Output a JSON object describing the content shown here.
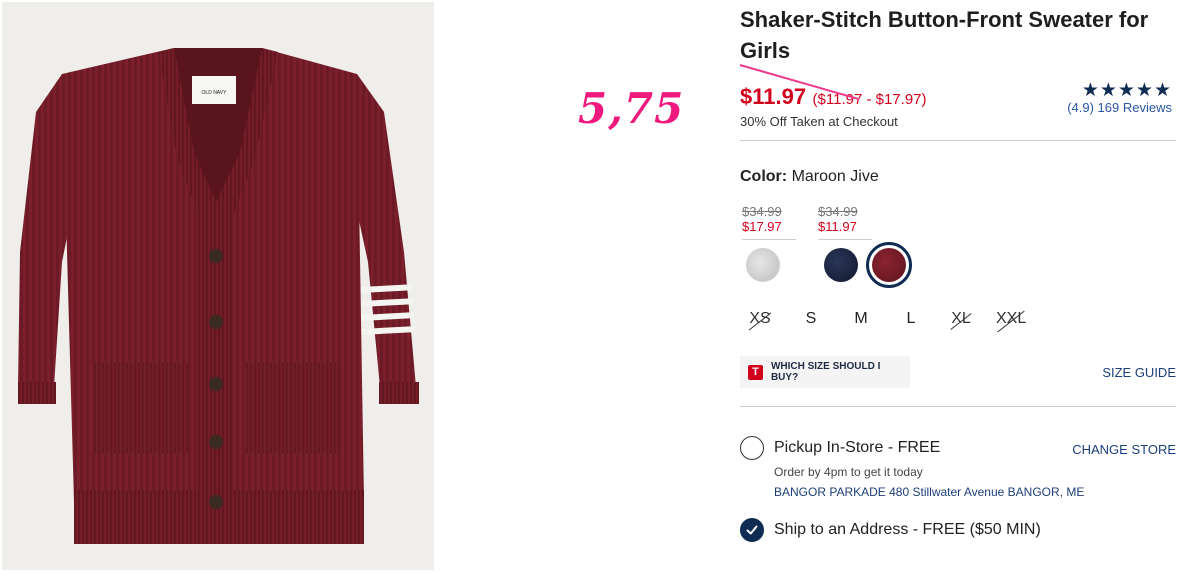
{
  "product": {
    "image_alt": "Maroon shaker-stitch cardigan sweater with white stripes on the sleeve",
    "brand_tag": "OLD NAVY",
    "title": "Shaker-Stitch Button-Front Sweater for Girls",
    "price_current": "$11.97",
    "price_range": "($11.97 - $17.97)",
    "discount_note": "30% Off Taken at Checkout",
    "handwritten_price": "5,75"
  },
  "rating": {
    "stars": "★★★★★",
    "reviews": "(4.9) 169 Reviews",
    "value": 4.9
  },
  "color": {
    "label": "Color:",
    "selected": "Maroon Jive",
    "price_groups": [
      {
        "old": "$34.99",
        "new": "$17.97"
      },
      {
        "old": "$34.99",
        "new": "$11.97"
      }
    ],
    "swatches": [
      {
        "name": "gray",
        "hex": "#c9c9c9"
      },
      {
        "name": "navy",
        "hex": "#1a2240"
      },
      {
        "name": "maroon",
        "hex": "#6e1a24"
      }
    ]
  },
  "sizes": [
    {
      "label": "XS",
      "available": false
    },
    {
      "label": "S",
      "available": true
    },
    {
      "label": "M",
      "available": true
    },
    {
      "label": "L",
      "available": true
    },
    {
      "label": "XL",
      "available": false
    },
    {
      "label": "XXL",
      "available": false
    }
  ],
  "size_help": {
    "icon_letter": "T",
    "label": "WHICH SIZE SHOULD I BUY?",
    "guide": "SIZE GUIDE"
  },
  "fulfillment": {
    "pickup": {
      "title": "Pickup In-Store - FREE",
      "note": "Order by 4pm to get it today",
      "store": "BANGOR PARKADE 480 Stillwater Avenue  BANGOR, ME",
      "change": "CHANGE STORE"
    },
    "ship": {
      "title": "Ship to an Address - FREE ($50 MIN)"
    }
  },
  "colors": {
    "sale_red": "#d1001c",
    "brand_navy": "#0f2d52",
    "link_blue": "#1c3f7a",
    "annotation_pink": "#f0197d"
  }
}
